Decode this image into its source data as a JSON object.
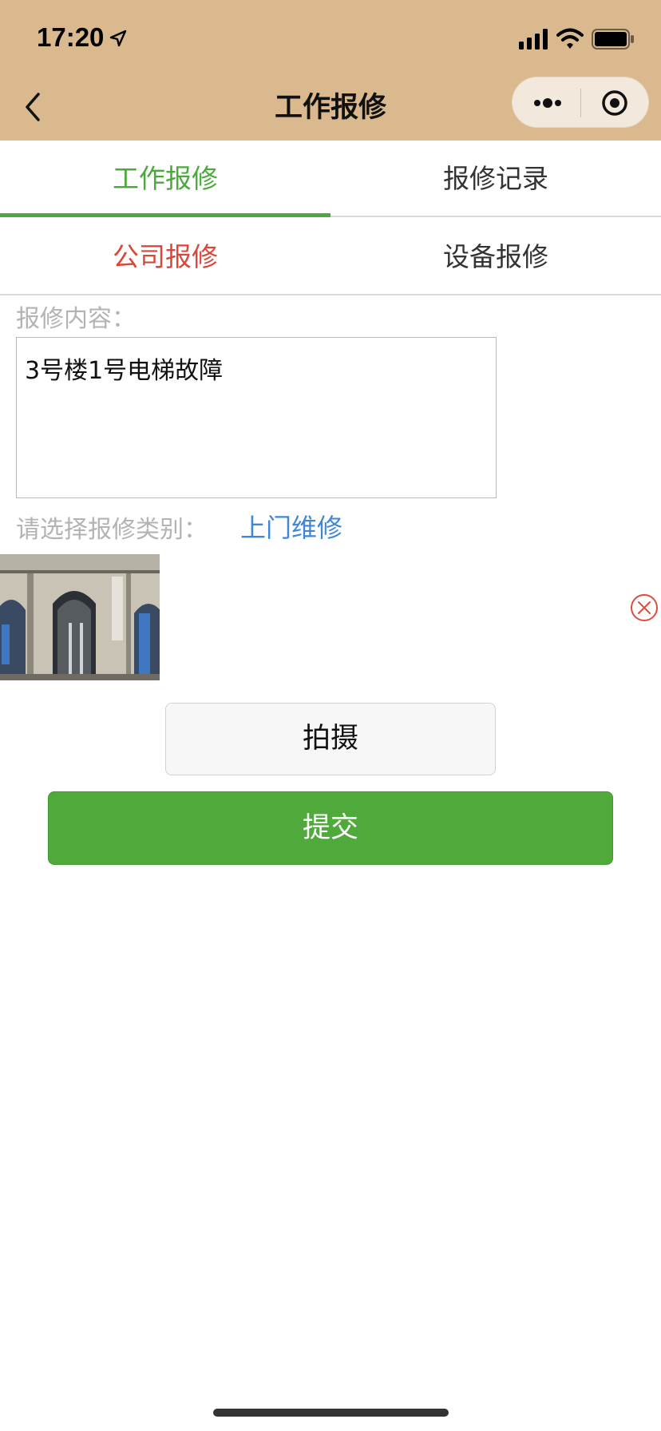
{
  "status_bar": {
    "time": "17:20",
    "icons": [
      "location-arrow-icon",
      "cellular-signal-icon",
      "wifi-icon",
      "battery-icon"
    ]
  },
  "nav": {
    "title": "工作报修",
    "icons": [
      "back-icon",
      "more-icon",
      "target-icon"
    ],
    "background": "#d9b98d"
  },
  "tabs": [
    {
      "label": "工作报修",
      "active": true
    },
    {
      "label": "报修记录",
      "active": false
    }
  ],
  "sub_tabs": [
    {
      "label": "公司报修",
      "active": true
    },
    {
      "label": "设备报修",
      "active": false
    }
  ],
  "form": {
    "content_label": "报修内容：",
    "content_value": "3号楼1号电梯故障",
    "category_label": "请选择报修类别：",
    "category_value": "上门维修"
  },
  "photo": {
    "remove_icon": "remove-icon"
  },
  "buttons": {
    "shoot": "拍摄",
    "submit": "提交"
  },
  "colors": {
    "accent_green": "#4caa3c",
    "submit_green": "#50aa3b",
    "active_red": "#d9463a",
    "link_blue": "#3d86d8",
    "header_tan": "#d9b98d"
  }
}
